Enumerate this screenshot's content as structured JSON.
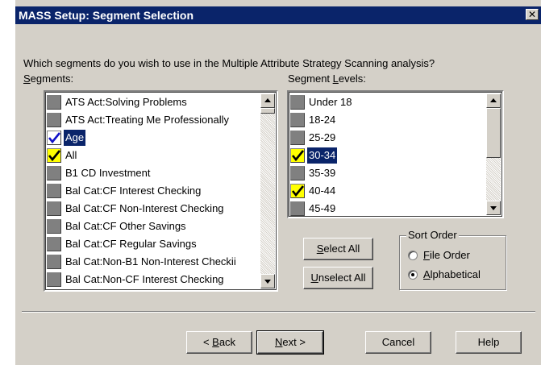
{
  "window": {
    "title": "MASS Setup: Segment Selection",
    "close_glyph": "✕"
  },
  "prompt": "Which segments do you wish to use in the Multiple Attribute Strategy Scanning analysis?",
  "segments": {
    "label_mnemonic": "S",
    "label_rest": "egments:",
    "items": [
      {
        "label": "ATS Act:Solving Problems",
        "checked": false,
        "selected": false
      },
      {
        "label": "ATS Act:Treating Me Professionally",
        "checked": false,
        "selected": false
      },
      {
        "label": "Age",
        "checked": true,
        "check_color": "blue",
        "selected": true
      },
      {
        "label": "All",
        "checked": true,
        "check_color": "yellow",
        "selected": false
      },
      {
        "label": "B1 CD Investment",
        "checked": false,
        "selected": false
      },
      {
        "label": "Bal Cat:CF Interest Checking",
        "checked": false,
        "selected": false
      },
      {
        "label": "Bal Cat:CF Non-Interest Checking",
        "checked": false,
        "selected": false
      },
      {
        "label": "Bal Cat:CF Other Savings",
        "checked": false,
        "selected": false
      },
      {
        "label": "Bal Cat:CF Regular Savings",
        "checked": false,
        "selected": false
      },
      {
        "label": "Bal Cat:Non-B1 Non-Interest Checkii",
        "checked": false,
        "selected": false
      },
      {
        "label": "Bal Cat:Non-CF Interest Checking",
        "checked": false,
        "selected": false
      }
    ]
  },
  "levels": {
    "label_text": "Segment ",
    "label_mnemonic": "L",
    "label_rest": "evels:",
    "items": [
      {
        "label": "Under 18",
        "checked": false,
        "selected": false
      },
      {
        "label": "18-24",
        "checked": false,
        "selected": false
      },
      {
        "label": "25-29",
        "checked": false,
        "selected": false
      },
      {
        "label": "30-34",
        "checked": true,
        "check_color": "yellow",
        "selected": true
      },
      {
        "label": "35-39",
        "checked": false,
        "selected": false
      },
      {
        "label": "40-44",
        "checked": true,
        "check_color": "yellow",
        "selected": false
      },
      {
        "label": "45-49",
        "checked": false,
        "selected": false
      }
    ]
  },
  "buttons": {
    "select_all_mnemonic": "S",
    "select_all_rest": "elect All",
    "unselect_all_mnemonic": "U",
    "unselect_all_rest": "nselect All",
    "back_prefix": "< ",
    "back_mnemonic": "B",
    "back_rest": "ack",
    "next_mnemonic": "N",
    "next_rest": "ext >",
    "cancel": "Cancel",
    "help": "Help"
  },
  "sort_order": {
    "legend": "Sort Order",
    "options": [
      {
        "mnemonic": "F",
        "rest": "ile Order",
        "selected": false
      },
      {
        "mnemonic": "A",
        "rest": "lphabetical",
        "selected": true
      }
    ]
  },
  "colors": {
    "title_bar": "#0a246a",
    "selection": "#0a246a",
    "dialog_face": "#d4d0c8",
    "check_yellow": "#ffff00",
    "check_blue": "#1010c8"
  }
}
